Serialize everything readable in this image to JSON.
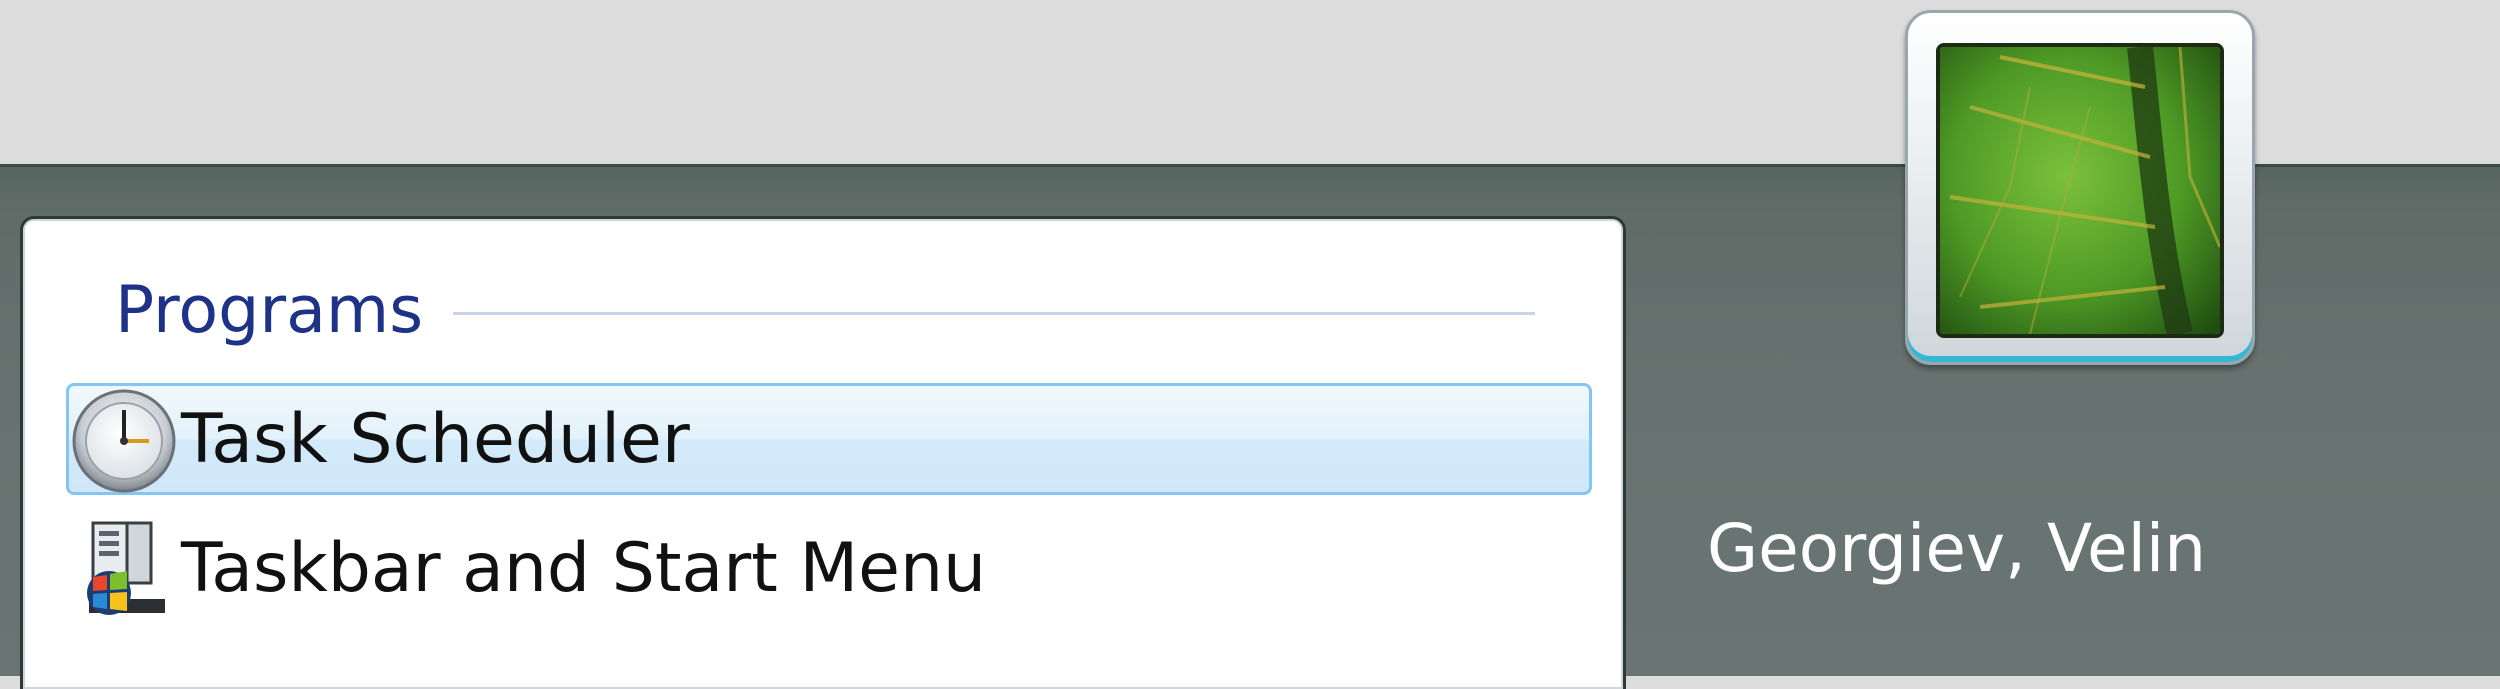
{
  "start_menu": {
    "search_results": {
      "section_title": "Programs",
      "items": [
        {
          "label": "Task Scheduler",
          "icon": "clock-icon",
          "selected": true
        },
        {
          "label": "Taskbar and Start Menu",
          "icon": "taskbar-start-menu-icon",
          "selected": false
        }
      ]
    },
    "user": {
      "name": "Georgiev, Velin",
      "picture": "leaf-picture"
    }
  },
  "colors": {
    "frame_background": "#66726f",
    "section_title": "#1e3287",
    "selection_border": "#84c6f3",
    "user_tile_accent": "#34b9d4"
  }
}
